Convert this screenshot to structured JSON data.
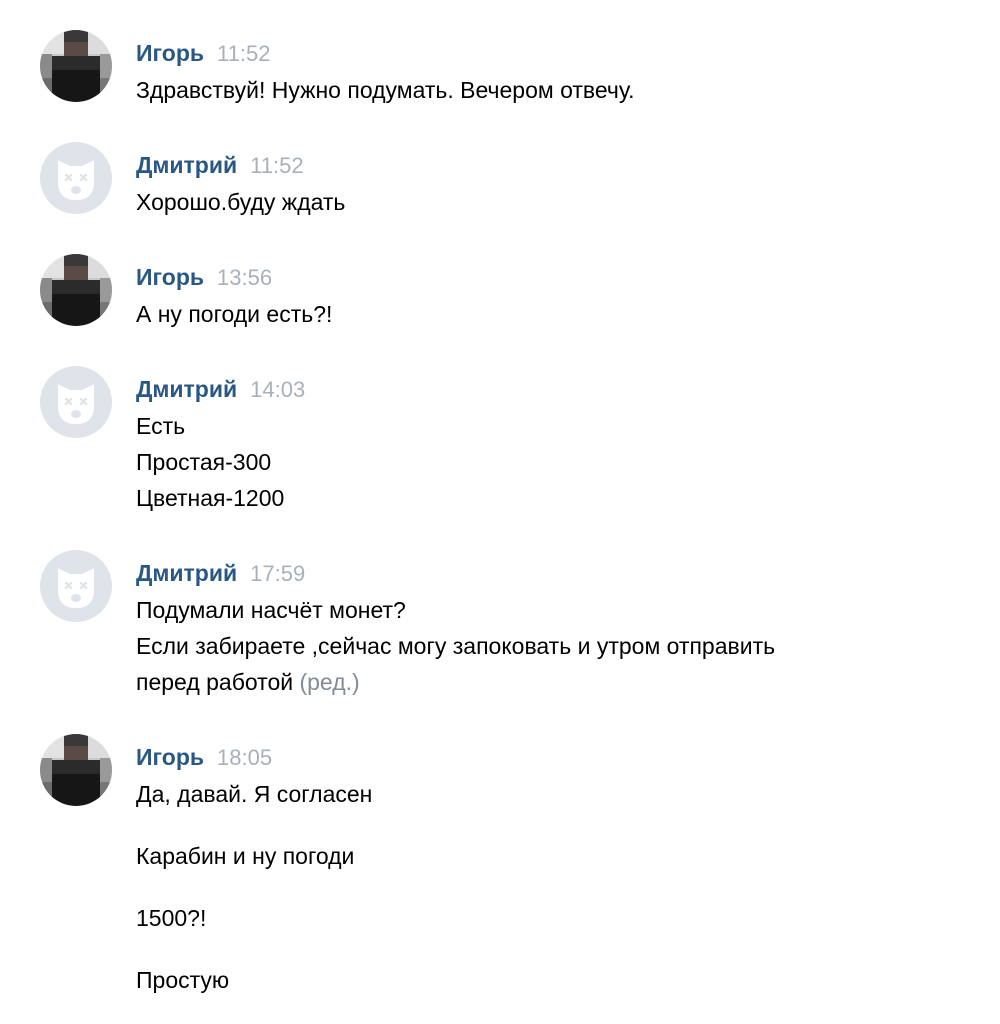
{
  "messages": [
    {
      "author": "Игорь",
      "time": "11:52",
      "avatar": "user-photo-pixelated",
      "lines": [
        "Здравствуй! Нужно подумать. Вечером отвечу."
      ]
    },
    {
      "author": "Дмитрий",
      "time": "11:52",
      "avatar": "default-dog-avatar",
      "lines": [
        "Хорошо.буду ждать"
      ]
    },
    {
      "author": "Игорь",
      "time": "13:56",
      "avatar": "user-photo-pixelated",
      "lines": [
        "А ну погоди есть?!"
      ]
    },
    {
      "author": "Дмитрий",
      "time": "14:03",
      "avatar": "default-dog-avatar",
      "lines": [
        "Есть",
        "Простая-300",
        "Цветная-1200"
      ]
    },
    {
      "author": "Дмитрий",
      "time": "17:59",
      "avatar": "default-dog-avatar",
      "lines": [
        "Подумали насчёт монет?",
        "Если забираете ,сейчас могу запоковать и утром отправить",
        "перед работой"
      ],
      "edited_label": "(ред.)"
    },
    {
      "author": "Игорь",
      "time": "18:05",
      "avatar": "user-photo-pixelated",
      "lines": [
        "Да, давай. Я согласен"
      ],
      "followups": [
        "Карабин и ну погоди",
        "1500?!",
        "Простую"
      ]
    }
  ],
  "colors": {
    "author": "#2a5885",
    "time": "#a8b1bb",
    "edited": "#828b96",
    "default_avatar_bg": "#dfe4ea"
  }
}
